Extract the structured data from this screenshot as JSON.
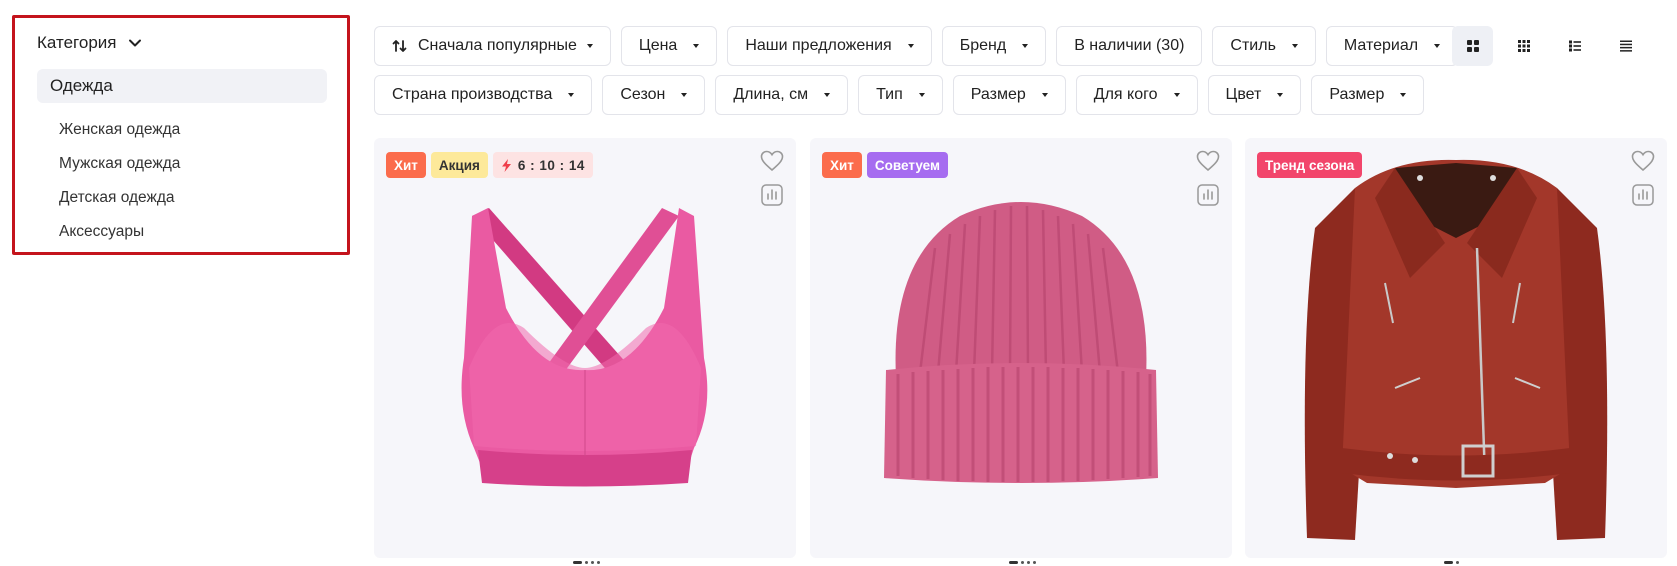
{
  "sidebar": {
    "title": "Категория",
    "active": "Одежда",
    "items": [
      {
        "label": "Женская одежда"
      },
      {
        "label": "Мужская одежда"
      },
      {
        "label": "Детская одежда"
      },
      {
        "label": "Аксессуары"
      }
    ]
  },
  "filters": {
    "row1": [
      {
        "label": "Сначала популярные",
        "icon": "sort-icon"
      },
      {
        "label": "Цена"
      },
      {
        "label": "Наши предложения"
      },
      {
        "label": "Бренд"
      },
      {
        "label": "В наличии (30)"
      },
      {
        "label": "Стиль"
      },
      {
        "label": "Материал"
      }
    ],
    "row2": [
      {
        "label": "Страна производства"
      },
      {
        "label": "Сезон"
      },
      {
        "label": "Длина, см"
      },
      {
        "label": "Тип"
      },
      {
        "label": "Размер"
      },
      {
        "label": "Для кого"
      },
      {
        "label": "Цвет"
      },
      {
        "label": "Размер"
      }
    ]
  },
  "view_modes": [
    "grid-large-icon",
    "grid-small-icon",
    "list-icon",
    "compact-list-icon"
  ],
  "products": [
    {
      "image": "pink-sports-bra",
      "badges": [
        "Хит",
        "Акция"
      ],
      "timer": "6 : 10 : 14"
    },
    {
      "image": "pink-knit-beanie",
      "badges": [
        "Хит",
        "Советуем"
      ]
    },
    {
      "image": "red-leather-jacket",
      "badges": [
        "Тренд сезона"
      ]
    }
  ],
  "colors": {
    "sidebar_border": "#c4141c",
    "badge_hit": "#fb6c4c",
    "badge_sale": "#fde99a",
    "badge_recommend": "#a66cf0",
    "badge_trend": "#f2456b"
  }
}
